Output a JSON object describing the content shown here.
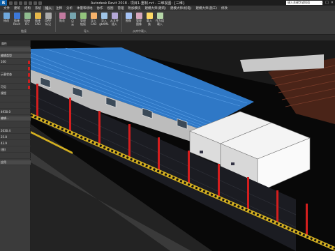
{
  "app": {
    "logo": "R",
    "window_title": "Autodesk Revit 2018 -   项目1-重制.rvt - 三维视图: {三维}",
    "search_placeholder": "键入关键字或短语",
    "controls": [
      "—",
      "□",
      "✕"
    ]
  },
  "tabs": [
    "文件",
    "建筑",
    "结构",
    "系统",
    "插入",
    "注释",
    "分析",
    "体量和场地",
    "协作",
    "视图",
    "管理",
    "附加模块",
    "建模大师(建筑)",
    "建模大师(机电)",
    "建模大师(施工)",
    "修改"
  ],
  "active_tab": 4,
  "ribbon": {
    "buttons": [
      {
        "label": "修改",
        "icon": "pointer-icon",
        "color": "#6fa8dc"
      },
      {
        "label": "链接\nRevit",
        "icon": "link-revit-icon",
        "color": "#3c78d8"
      },
      {
        "label": "链接\nIFC",
        "icon": "link-ifc-icon",
        "color": "#8fbc8f"
      },
      {
        "label": "链接\nCAD",
        "icon": "link-cad-icon",
        "color": "#e6b84a"
      },
      {
        "label": "DWF\n标记",
        "icon": "dwf-icon",
        "color": "#aaaaaa"
      },
      {
        "label": "贴花",
        "icon": "decal-icon",
        "color": "#c27ba0"
      },
      {
        "label": "点\n云",
        "icon": "point-cloud-icon",
        "color": "#76a5af"
      },
      {
        "label": "管理\n链接",
        "icon": "manage-links-icon",
        "color": "#93c47d"
      },
      {
        "label": "导入\nCAD",
        "icon": "import-cad-icon",
        "color": "#f6b26b"
      },
      {
        "label": "导入\ngbXML",
        "icon": "gbxml-icon",
        "color": "#9fc5e8"
      },
      {
        "label": "从文件\n插入",
        "icon": "insert-file-icon",
        "color": "#b4a7d6"
      },
      {
        "label": "图像",
        "icon": "image-icon",
        "color": "#a4c2f4"
      },
      {
        "label": "管理\n图像",
        "icon": "manage-image-icon",
        "color": "#d5a6bd"
      },
      {
        "label": "载入\n族",
        "icon": "load-family-icon",
        "color": "#ffd966"
      },
      {
        "label": "作为组\n载入",
        "icon": "load-group-icon",
        "color": "#b6d7a8"
      }
    ],
    "panel_labels": [
      "链接",
      "导入",
      "从库中载入"
    ]
  },
  "properties": {
    "header": "属性",
    "rows": [
      {
        "text": "",
        "box": true
      },
      {
        "text": "编辑类型",
        "box": true
      },
      {
        "text": "100",
        "box": false
      },
      {
        "text": "",
        "box": false
      },
      {
        "text": "示意状态",
        "box": false
      },
      {
        "text": "",
        "box": false
      },
      {
        "text": "可见",
        "box": false
      },
      {
        "text": "规程",
        "box": false
      },
      {
        "text": "",
        "box": false
      },
      {
        "text": "",
        "box": false
      },
      {
        "text": "4930.0",
        "box": false
      },
      {
        "text": "编辑...",
        "box": true
      },
      {
        "text": "",
        "box": false
      },
      {
        "text": "2030.4",
        "box": false
      },
      {
        "text": "25.8",
        "box": false
      },
      {
        "text": "43.9",
        "box": false
      },
      {
        "text": "(图)",
        "box": false
      },
      {
        "text": "",
        "box": false
      },
      {
        "text": "应用",
        "box": true
      }
    ]
  }
}
